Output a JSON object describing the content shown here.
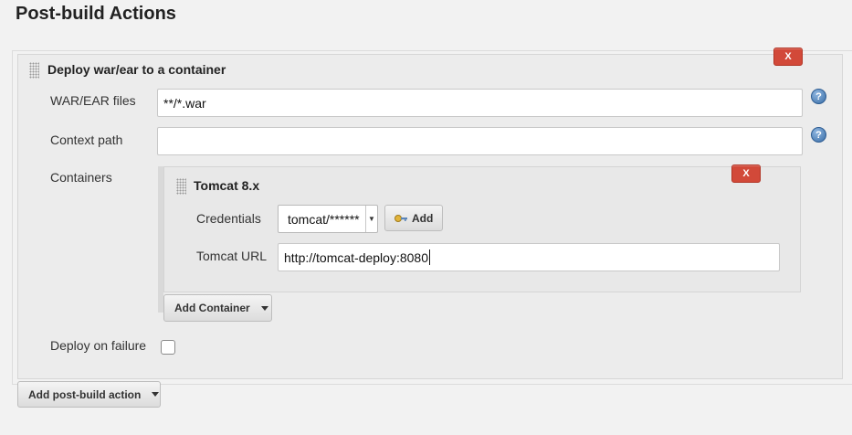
{
  "section": {
    "title": "Post-build Actions"
  },
  "deploy_block": {
    "title": "Deploy war/ear to a container",
    "close_label": "X",
    "fields": {
      "war_files": {
        "label": "WAR/EAR files",
        "value": "**/*.war",
        "help": "?"
      },
      "context_path": {
        "label": "Context path",
        "value": "",
        "help": "?"
      },
      "containers": {
        "label": "Containers"
      },
      "deploy_on_failure": {
        "label": "Deploy on failure",
        "checked": false
      }
    }
  },
  "container": {
    "title": "Tomcat 8.x",
    "close_label": "X",
    "credentials": {
      "label": "Credentials",
      "selected": "tomcat/******"
    },
    "add_button": {
      "label": "Add"
    },
    "tomcat_url": {
      "label": "Tomcat URL",
      "value": "http://tomcat-deploy:8080"
    },
    "add_container": {
      "label": "Add Container"
    }
  },
  "add_post_build": {
    "label": "Add post-build action"
  },
  "colors": {
    "close": "#d24939",
    "help": "#3b6fa8",
    "panel": "#ececec"
  },
  "icons": {
    "drag": "drag-handle-icon",
    "help": "help-icon",
    "key": "key-icon",
    "dropdown": "caret-down-icon"
  }
}
